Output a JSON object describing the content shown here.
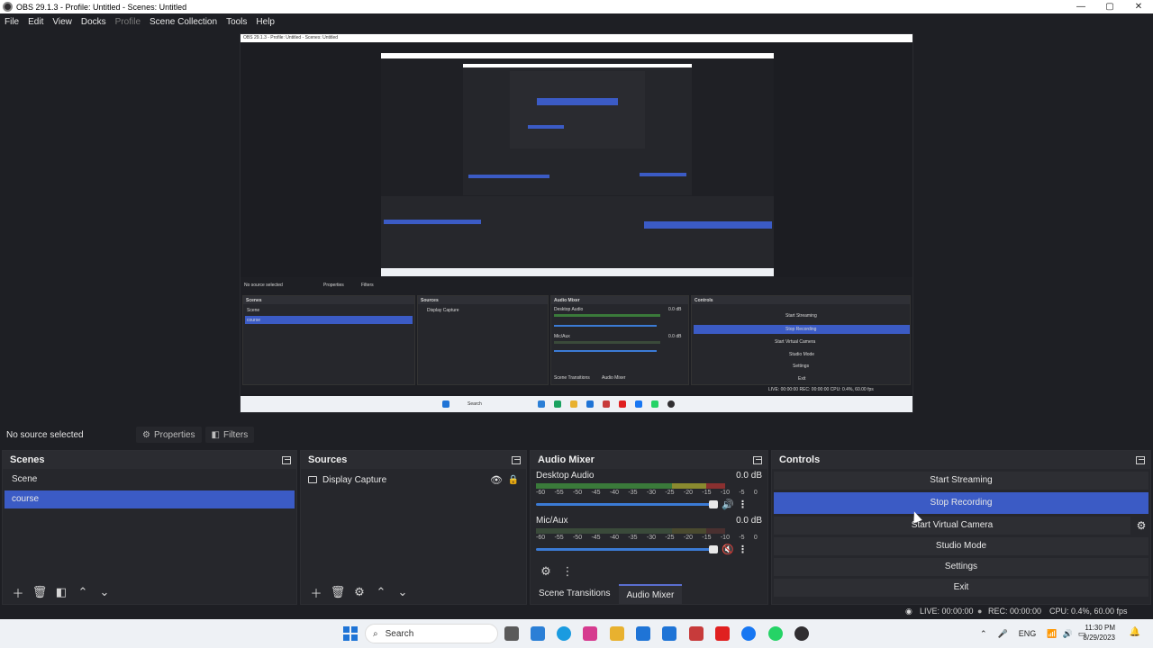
{
  "window": {
    "title": "OBS 29.1.3 - Profile: Untitled - Scenes: Untitled",
    "minimize": "—",
    "maximize": "▢",
    "close": "✕"
  },
  "menu": {
    "file": "File",
    "edit": "Edit",
    "view": "View",
    "docks": "Docks",
    "profile": "Profile",
    "scene_collection": "Scene Collection",
    "tools": "Tools",
    "help": "Help"
  },
  "source_toolbar": {
    "no_source": "No source selected",
    "properties": "Properties",
    "filters": "Filters"
  },
  "scenes": {
    "title": "Scenes",
    "items": [
      {
        "label": "Scene",
        "selected": false
      },
      {
        "label": "course",
        "selected": true
      }
    ]
  },
  "sources": {
    "title": "Sources",
    "items": [
      {
        "label": "Display Capture"
      }
    ]
  },
  "mixer": {
    "title": "Audio Mixer",
    "channels": [
      {
        "name": "Desktop Audio",
        "db": "0.0 dB",
        "muted": false
      },
      {
        "name": "Mic/Aux",
        "db": "0.0 dB",
        "muted": true
      }
    ],
    "scale": [
      "-60",
      "-55",
      "-50",
      "-45",
      "-40",
      "-35",
      "-30",
      "-25",
      "-20",
      "-15",
      "-10",
      "-5",
      "0"
    ],
    "tabs": {
      "scene_transitions": "Scene Transitions",
      "audio_mixer": "Audio Mixer"
    }
  },
  "controls": {
    "title": "Controls",
    "start_streaming": "Start Streaming",
    "stop_recording": "Stop Recording",
    "start_virtual_camera": "Start Virtual Camera",
    "studio_mode": "Studio Mode",
    "settings": "Settings",
    "exit": "Exit"
  },
  "status": {
    "live": "LIVE: 00:00:00",
    "rec": "REC: 00:00:00",
    "cpu": "CPU: 0.4%, 60.00 fps"
  },
  "taskbar": {
    "search": "Search",
    "lang": "ENG",
    "time": "11:30 PM",
    "date": "8/29/2023"
  },
  "preview": {
    "title": "OBS 29.1.3 - Profile: Untitled - Scenes: Untitled",
    "no_source": "No source selected",
    "properties": "Properties",
    "filters": "Filters",
    "scenes": "Scenes",
    "scene": "Scene",
    "course": "course",
    "sources": "Sources",
    "display_capture": "Display Capture",
    "audio_mixer": "Audio Mixer",
    "desktop_audio": "Desktop Audio",
    "mic_aux": "Mic/Aux",
    "db": "0.0 dB",
    "controls": "Controls",
    "start_streaming": "Start Streaming",
    "stop_recording": "Stop Recording",
    "start_virtual_camera": "Start Virtual Camera",
    "studio_mode": "Studio Mode",
    "settings": "Settings",
    "exit": "Exit",
    "scene_transitions": "Scene Transitions",
    "status": "LIVE: 00:00:00   REC: 00:00:00   CPU: 0.4%, 60.00 fps",
    "search": "Search"
  },
  "colors": {
    "accent": "#3b5bc5",
    "background": "#1e1f24",
    "panel": "#26272c"
  }
}
